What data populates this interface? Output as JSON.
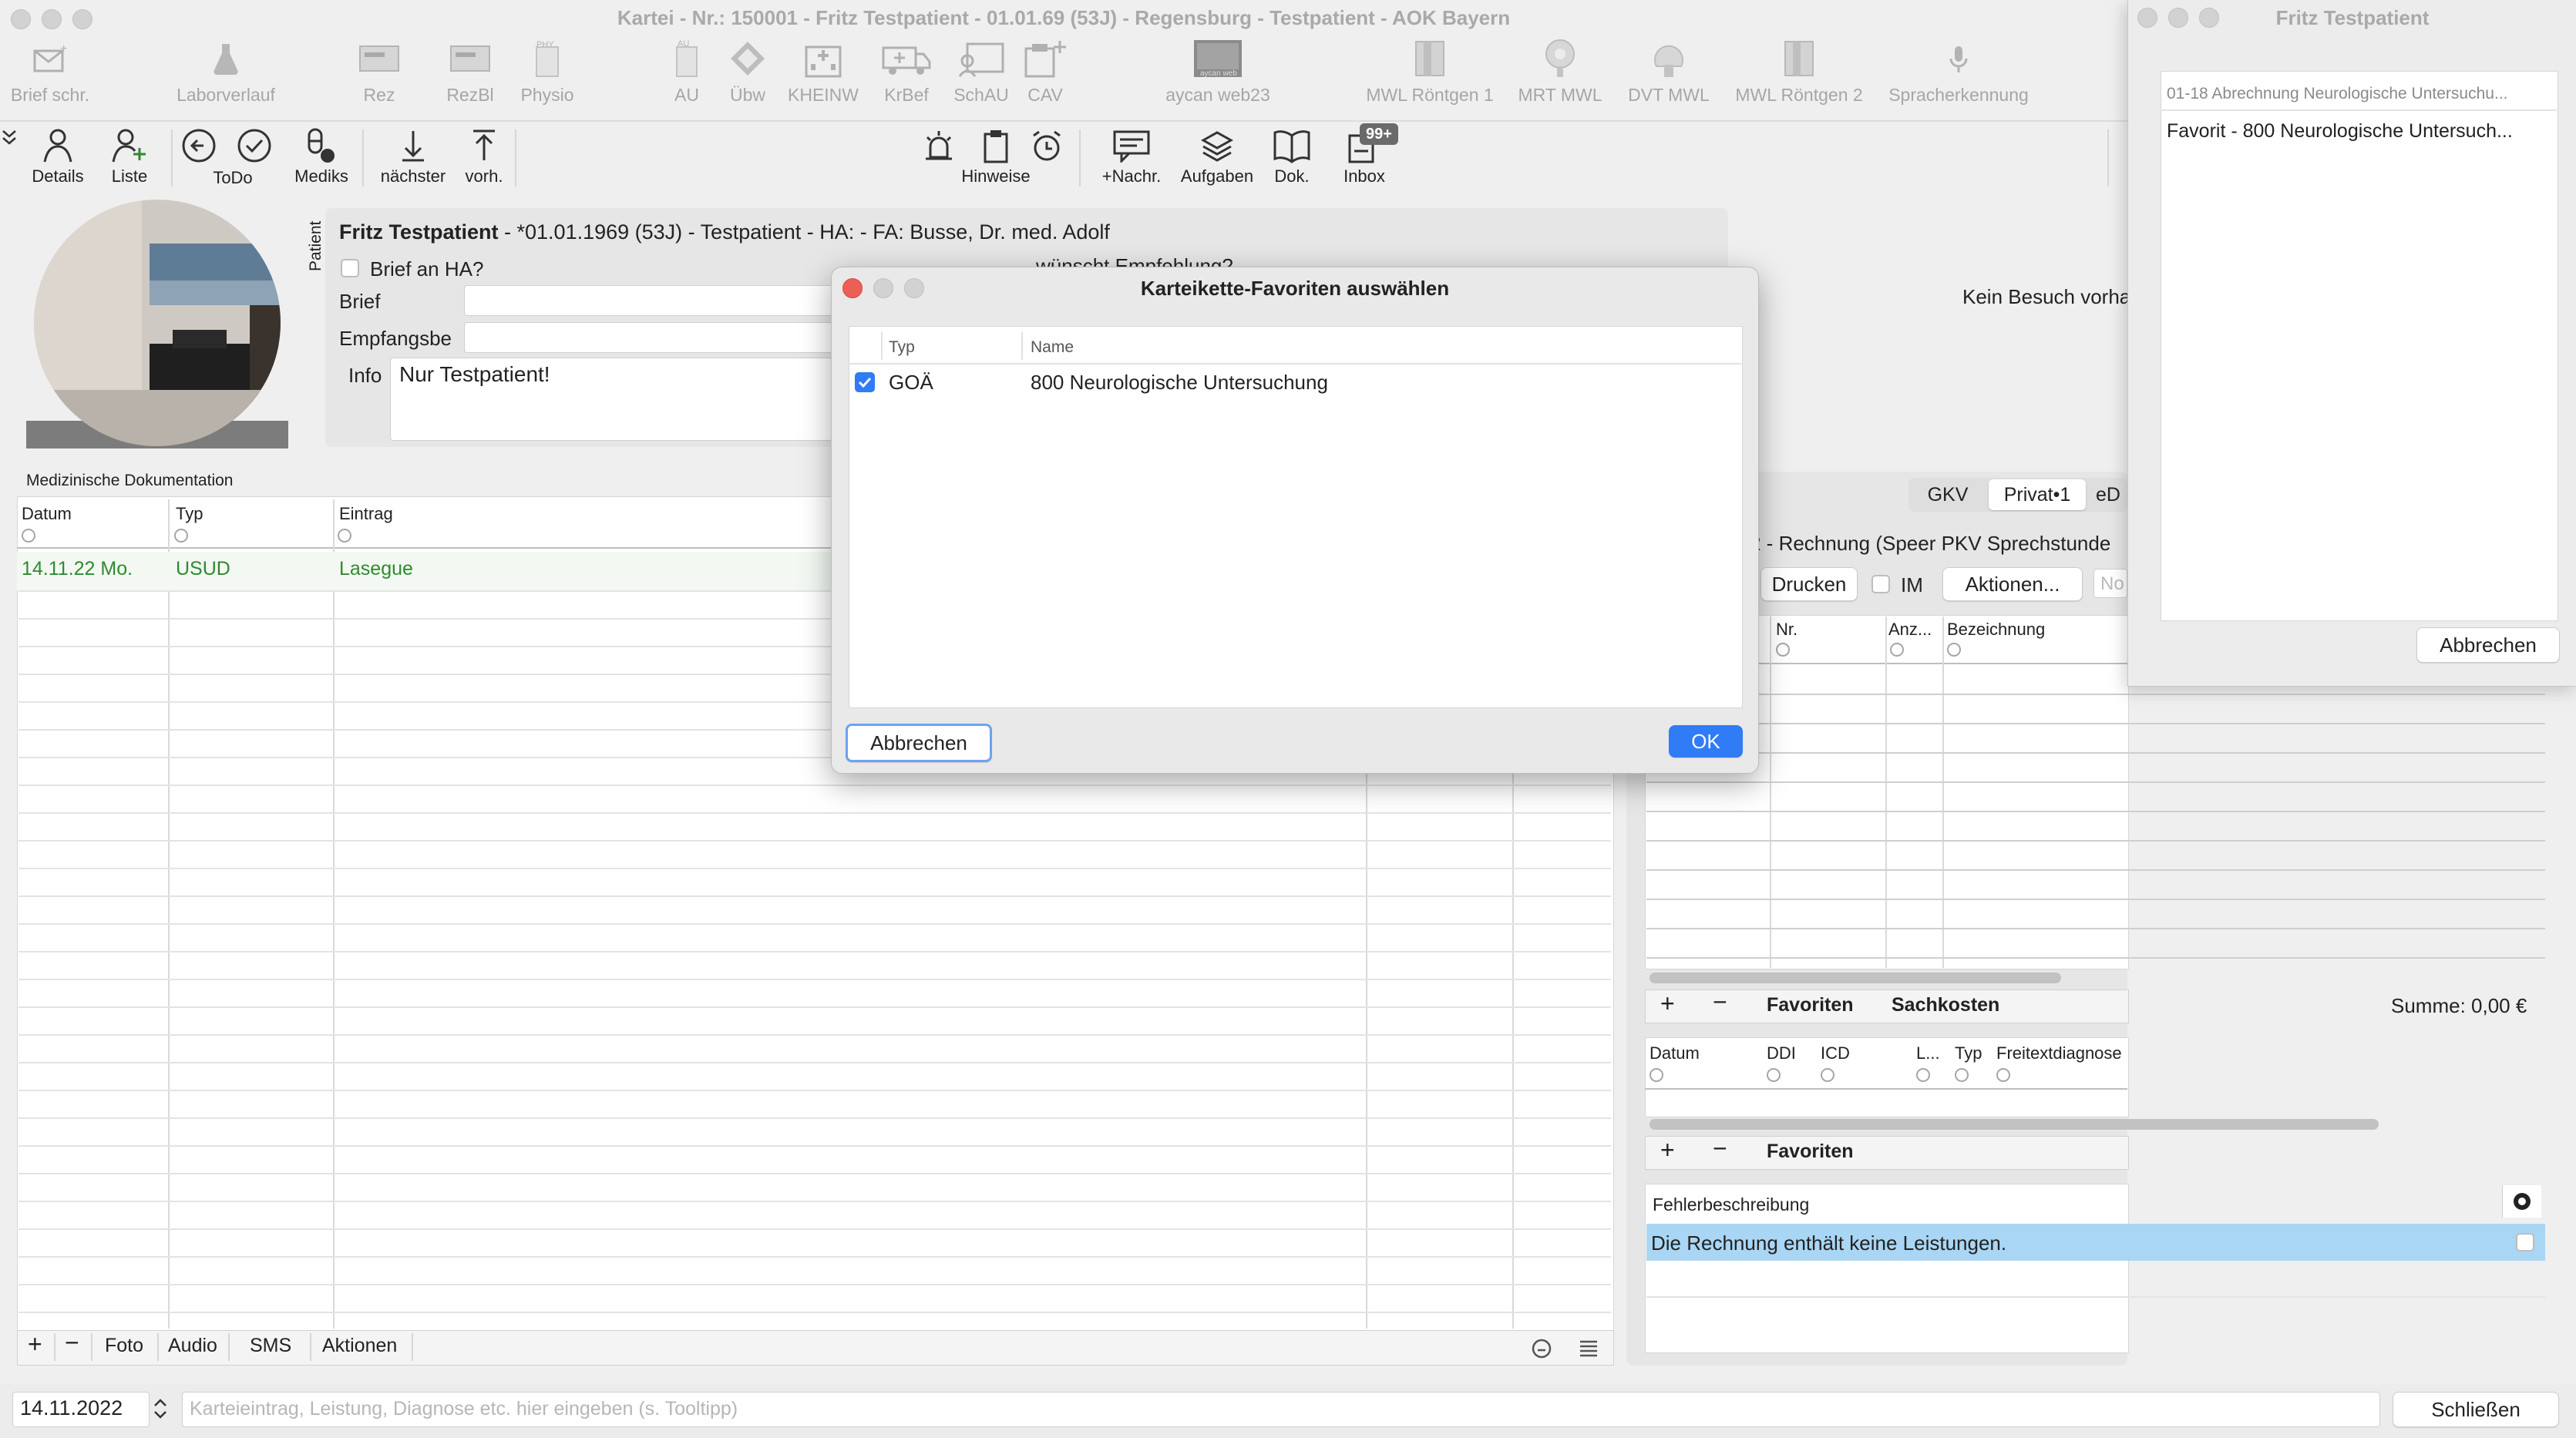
{
  "window": {
    "title": "Kartei - Nr.: 150001 - Fritz Testpatient - 01.01.69 (53J) - Regensburg - Testpatient - AOK Bayern"
  },
  "toolbar_top": [
    {
      "label": "Brief schr.",
      "icon": "letter-icon"
    },
    {
      "label": "Laborverlauf",
      "icon": "flask-icon"
    },
    {
      "label": "Rez",
      "icon": "prescription-icon"
    },
    {
      "label": "RezBl",
      "icon": "prescription-blank-icon"
    },
    {
      "label": "Physio",
      "icon": "physio-icon"
    },
    {
      "label": "AU",
      "icon": "sick-note-icon"
    },
    {
      "label": "Übw",
      "icon": "referral-icon"
    },
    {
      "label": "KHEINW",
      "icon": "hospital-icon"
    },
    {
      "label": "KrBef",
      "icon": "ambulance-icon"
    },
    {
      "label": "SchAU",
      "icon": "school-icon"
    },
    {
      "label": "CAV",
      "icon": "clipboard-add-icon"
    },
    {
      "label": "aycan web23",
      "icon": "aycan-icon"
    },
    {
      "label": "MWL Röntgen 1",
      "icon": "xray-icon"
    },
    {
      "label": "MRT MWL",
      "icon": "mrt-icon"
    },
    {
      "label": "DVT MWL",
      "icon": "dvt-icon"
    },
    {
      "label": "MWL Röntgen 2",
      "icon": "xray2-icon"
    },
    {
      "label": "Spracherkennung",
      "icon": "microphone-icon"
    }
  ],
  "toolbar_bottom": {
    "details": "Details",
    "liste": "Liste",
    "todo": "ToDo",
    "mediks": "Mediks",
    "naechster": "nächster",
    "vorh": "vorh.",
    "hinweise": "Hinweise",
    "nachr": "+Nachr.",
    "aufgaben": "Aufgaben",
    "dok": "Dok.",
    "inbox": "Inbox",
    "inbox_badge": "99+"
  },
  "patient": {
    "side_label": "Patient",
    "header": "Fritz Testpatient",
    "header_rest": " - *01.01.1969 (53J) - Testpatient - HA:  - FA: Busse, Dr. med. Adolf",
    "brief_an_ha": "Brief an HA?",
    "brief_label": "Brief",
    "empfangsbe_label": "Empfangsbe",
    "info_label": "Info",
    "info_value": "Nur Testpatient!",
    "empfehlung_fragment": "wünscht Empfehlung?",
    "kein_besuch": "Kein Besuch vorha"
  },
  "med_doc": {
    "title": "Medizinische Dokumentation",
    "columns": [
      "Datum",
      "Typ",
      "Eintrag"
    ],
    "rows": [
      {
        "datum": "14.11.22  Mo.",
        "typ": "USUD",
        "eintrag": "Lasegue"
      }
    ],
    "bottom_tabs": [
      "Foto",
      "Audio",
      "SMS",
      "Aktionen"
    ]
  },
  "billing": {
    "tabs": [
      "GKV",
      "Privat•1",
      "eD"
    ],
    "rechnung_title": "2 - Rechnung (Speer PKV Sprechstunde",
    "drucken": "Drucken",
    "im": "IM",
    "aktionen": "Aktionen...",
    "no_placeholder": "No",
    "columns": [
      "Nr.",
      "Anz...",
      "Bezeichnung"
    ],
    "favoriten": "Favoriten",
    "sachkosten": "Sachkosten",
    "summe": "Summe: 0,00 €"
  },
  "diagnosis": {
    "columns": [
      "Datum",
      "DDI",
      "ICD",
      "L...",
      "Typ",
      "Freitextdiagnose"
    ],
    "favoriten": "Favoriten"
  },
  "errors": {
    "title": "Fehlerbeschreibung",
    "message": "Die Rechnung enthält keine Leistungen."
  },
  "footer": {
    "date": "14.11.2022",
    "input_placeholder": "Karteieintrag, Leistung, Diagnose etc. hier eingeben (s. Tooltipp)",
    "schliessen": "Schließen"
  },
  "modal": {
    "title": "Karteikette-Favoriten auswählen",
    "columns": [
      "Typ",
      "Name"
    ],
    "rows": [
      {
        "checked": true,
        "typ": "GOÄ",
        "name": "800 Neurologische Untersuchung"
      }
    ],
    "cancel": "Abbrechen",
    "ok": "OK"
  },
  "side_window": {
    "title": "Fritz Testpatient",
    "items": [
      "01-18 Abrechnung Neurologische Untersuchu...",
      "Favorit - 800 Neurologische Untersuch..."
    ],
    "cancel": "Abbrechen"
  },
  "colors": {
    "accent": "#2f7cf6",
    "green_text": "#2f8a2f",
    "error_highlight": "#a9d6f5"
  }
}
